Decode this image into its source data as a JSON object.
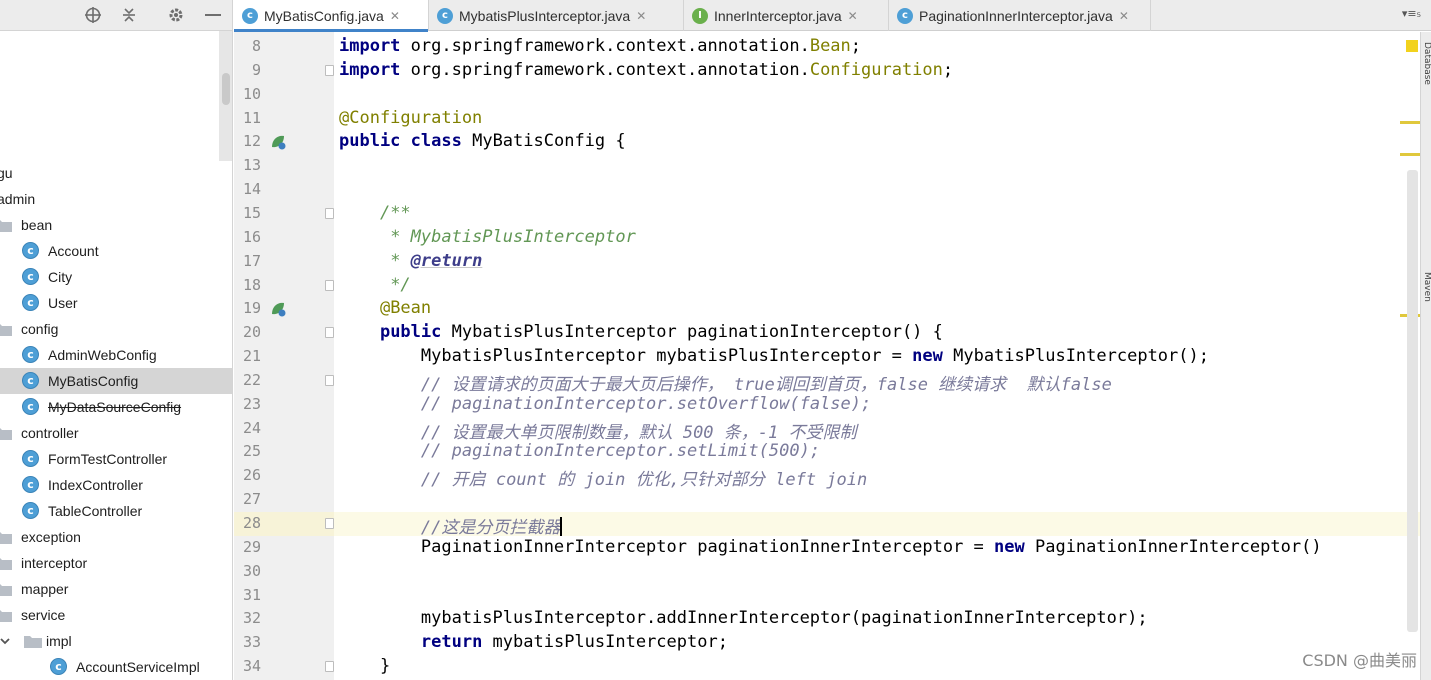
{
  "tabs": [
    {
      "label": "MyBatisConfig.java",
      "icon": "class-icon",
      "active": true
    },
    {
      "label": "MybatisPlusInterceptor.java",
      "icon": "class-icon",
      "active": false
    },
    {
      "label": "InnerInterceptor.java",
      "icon": "interface-icon",
      "active": false
    },
    {
      "label": "PaginationInnerInterceptor.java",
      "icon": "class-icon",
      "active": false
    }
  ],
  "tab_menu": "▾≡₅",
  "tree": [
    {
      "label": "gu",
      "kind": "text"
    },
    {
      "label": "admin",
      "kind": "text"
    },
    {
      "label": "bean",
      "kind": "folder"
    },
    {
      "label": "Account",
      "kind": "class"
    },
    {
      "label": "City",
      "kind": "class"
    },
    {
      "label": "User",
      "kind": "class"
    },
    {
      "label": "config",
      "kind": "folder"
    },
    {
      "label": "AdminWebConfig",
      "kind": "class"
    },
    {
      "label": "MyBatisConfig",
      "kind": "class",
      "selected": true
    },
    {
      "label": "MyDataSourceConfig",
      "kind": "class",
      "strike": true
    },
    {
      "label": "controller",
      "kind": "folder"
    },
    {
      "label": "FormTestController",
      "kind": "class"
    },
    {
      "label": "IndexController",
      "kind": "class"
    },
    {
      "label": "TableController",
      "kind": "class"
    },
    {
      "label": "exception",
      "kind": "folder"
    },
    {
      "label": "interceptor",
      "kind": "folder"
    },
    {
      "label": "mapper",
      "kind": "folder"
    },
    {
      "label": "service",
      "kind": "folder"
    },
    {
      "label": "impl",
      "kind": "folder",
      "expanded": true
    },
    {
      "label": "AccountServiceImpl",
      "kind": "class"
    }
  ],
  "code_lines": [
    {
      "n": "8",
      "tokens": [
        {
          "t": "import",
          "c": "kw"
        },
        {
          "t": " org.springframework.context.annotation."
        },
        {
          "t": "Bean",
          "c": "bean-hl"
        },
        {
          "t": ";"
        }
      ]
    },
    {
      "n": "9",
      "tokens": [
        {
          "t": "import",
          "c": "kw"
        },
        {
          "t": " org.springframework.context.annotation."
        },
        {
          "t": "Configuration",
          "c": "bean-hl"
        },
        {
          "t": ";"
        }
      ]
    },
    {
      "n": "10",
      "tokens": []
    },
    {
      "n": "11",
      "tokens": [
        {
          "t": "@Configuration",
          "c": "ann"
        }
      ]
    },
    {
      "n": "12",
      "tokens": [
        {
          "t": "public",
          "c": "kw"
        },
        {
          "t": " "
        },
        {
          "t": "class",
          "c": "kw"
        },
        {
          "t": " MyBatisConfig {"
        }
      ],
      "gutter_icon": "bean-icon"
    },
    {
      "n": "13",
      "tokens": []
    },
    {
      "n": "14",
      "tokens": []
    },
    {
      "n": "15",
      "tokens": [
        {
          "t": "    "
        },
        {
          "t": "/**",
          "c": "doc"
        }
      ]
    },
    {
      "n": "16",
      "tokens": [
        {
          "t": "     "
        },
        {
          "t": "* MybatisPlusInterceptor",
          "c": "doc"
        }
      ]
    },
    {
      "n": "17",
      "tokens": [
        {
          "t": "     "
        },
        {
          "t": "* ",
          "c": "doc"
        },
        {
          "t": "@return",
          "c": "doctag"
        }
      ]
    },
    {
      "n": "18",
      "tokens": [
        {
          "t": "     "
        },
        {
          "t": "*/",
          "c": "doc"
        }
      ]
    },
    {
      "n": "19",
      "tokens": [
        {
          "t": "    "
        },
        {
          "t": "@Bean",
          "c": "ann"
        }
      ],
      "gutter_icon": "bean-method-icon"
    },
    {
      "n": "20",
      "tokens": [
        {
          "t": "    "
        },
        {
          "t": "public",
          "c": "kw"
        },
        {
          "t": " MybatisPlusInterceptor paginationInterceptor() {"
        }
      ]
    },
    {
      "n": "21",
      "tokens": [
        {
          "t": "        MybatisPlusInterceptor mybatisPlusInterceptor = "
        },
        {
          "t": "new",
          "c": "kw"
        },
        {
          "t": " MybatisPlusInterceptor();"
        }
      ]
    },
    {
      "n": "22",
      "tokens": [
        {
          "t": "        "
        },
        {
          "t": "// 设置请求的页面大于最大页后操作， true调回到首页，false 继续请求  默认false",
          "c": "cmtcn"
        }
      ]
    },
    {
      "n": "23",
      "tokens": [
        {
          "t": "        "
        },
        {
          "t": "// paginationInterceptor.setOverflow(false);",
          "c": "cmtcn"
        }
      ]
    },
    {
      "n": "24",
      "tokens": [
        {
          "t": "        "
        },
        {
          "t": "// 设置最大单页限制数量，默认 500 条，-1 不受限制",
          "c": "cmtcn"
        }
      ]
    },
    {
      "n": "25",
      "tokens": [
        {
          "t": "        "
        },
        {
          "t": "// paginationInterceptor.setLimit(500);",
          "c": "cmtcn"
        }
      ]
    },
    {
      "n": "26",
      "tokens": [
        {
          "t": "        "
        },
        {
          "t": "// 开启 count 的 join 优化,只针对部分 left join",
          "c": "cmtcn"
        }
      ]
    },
    {
      "n": "27",
      "tokens": []
    },
    {
      "n": "28",
      "tokens": [
        {
          "t": "        "
        },
        {
          "t": "//这是分页拦截器",
          "c": "cmtcn"
        }
      ],
      "current": true
    },
    {
      "n": "29",
      "tokens": [
        {
          "t": "        PaginationInnerInterceptor paginationInnerInterceptor = "
        },
        {
          "t": "new",
          "c": "kw"
        },
        {
          "t": " PaginationInnerInterceptor()"
        }
      ]
    },
    {
      "n": "30",
      "tokens": []
    },
    {
      "n": "31",
      "tokens": []
    },
    {
      "n": "32",
      "tokens": [
        {
          "t": "        mybatisPlusInterceptor.addInnerInterceptor(paginationInnerInterceptor);"
        }
      ]
    },
    {
      "n": "33",
      "tokens": [
        {
          "t": "        "
        },
        {
          "t": "return",
          "c": "kw"
        },
        {
          "t": " mybatisPlusInterceptor;"
        }
      ]
    },
    {
      "n": "34",
      "tokens": [
        {
          "t": "    }"
        }
      ]
    }
  ],
  "right_strip_labels": [
    "Database",
    "Maven"
  ],
  "watermark": "CSDN @曲美丽",
  "colors": {
    "keyword": "#000080",
    "annotation": "#808000",
    "doc_comment": "#629755",
    "comment": "#7a7a9a",
    "current_line": "#fcfae6",
    "tab_accent": "#4083c9"
  }
}
